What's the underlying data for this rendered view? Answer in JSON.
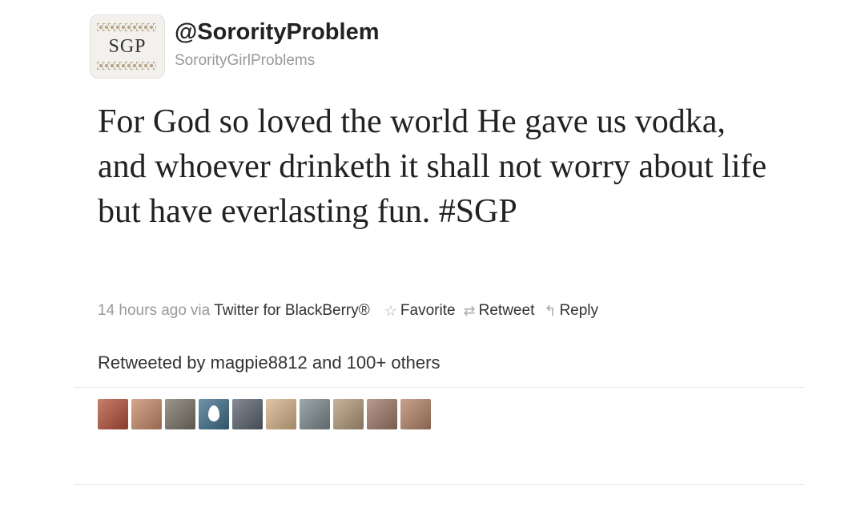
{
  "user": {
    "avatar_initials": "SGP",
    "screen_name": "@SororityProblem",
    "full_name": "SororityGirlProblems"
  },
  "tweet": {
    "text": "For God so loved the world He gave us vodka, and whoever drinketh it shall not worry about life but have everlasting fun.",
    "hashtag": "#SGP"
  },
  "meta": {
    "timestamp": "14 hours ago",
    "via": "via",
    "source": "Twitter for BlackBerry®",
    "actions": {
      "favorite": "Favorite",
      "retweet": "Retweet",
      "reply": "Reply"
    }
  },
  "retweeted_by": "Retweeted by magpie8812 and 100+ others",
  "retweeter_avatars": [
    {
      "color": "#b5523a"
    },
    {
      "color": "#c98a6a"
    },
    {
      "color": "#7a7466"
    },
    {
      "color": "#3f6f8c"
    },
    {
      "color": "#5c6470"
    },
    {
      "color": "#d7b48a"
    },
    {
      "color": "#7d8a8f"
    },
    {
      "color": "#b49a7a"
    },
    {
      "color": "#a07a6a"
    },
    {
      "color": "#b58468"
    }
  ]
}
